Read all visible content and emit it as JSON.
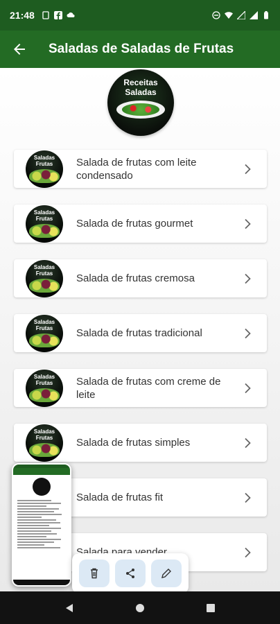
{
  "status_bar": {
    "time": "21:48",
    "left_icons": [
      "sim-icon",
      "facebook-icon",
      "cloud-icon"
    ],
    "right_icons": [
      "dnd-icon",
      "wifi-icon",
      "signal-icon",
      "signal-icon-2",
      "battery-icon"
    ]
  },
  "app_bar": {
    "title": "Saladas de Saladas de Frutas",
    "back_icon": "arrow-back-icon"
  },
  "header_logo": {
    "line1": "Receitas",
    "line2": "Saladas"
  },
  "thumb": {
    "line1": "Saladas",
    "line2": "Frutas"
  },
  "items": [
    {
      "label": "Salada de frutas com leite condensado"
    },
    {
      "label": "Salada de frutas gourmet"
    },
    {
      "label": "Salada de frutas cremosa"
    },
    {
      "label": "Salada de frutas tradicional"
    },
    {
      "label": "Salada de frutas com creme de leite"
    },
    {
      "label": "Salada de frutas simples"
    },
    {
      "label": "Salada de frutas fit"
    },
    {
      "label": "Salada para vender"
    }
  ],
  "actions": [
    "delete-icon",
    "share-icon",
    "edit-icon"
  ],
  "nav_icons": [
    "nav-back-icon",
    "nav-home-icon",
    "nav-recents-icon"
  ],
  "colors": {
    "primary_dark": "#1e5c20",
    "primary": "#236b24",
    "action_bg": "#dce9f5"
  }
}
